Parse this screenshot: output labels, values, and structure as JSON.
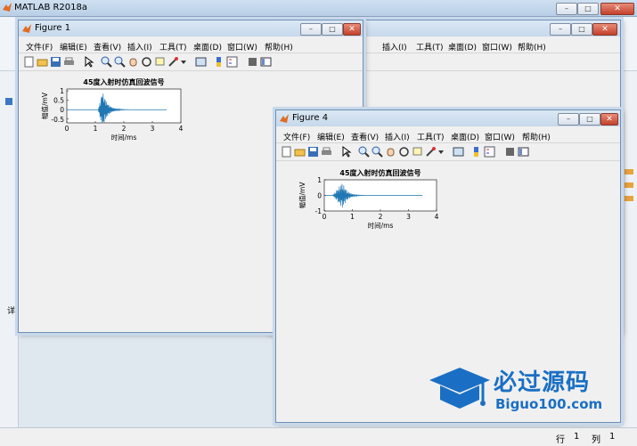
{
  "main": {
    "title": "MATLAB R2018a",
    "status": {
      "row_label": "行",
      "row": "1",
      "col_label": "列",
      "col": "1"
    }
  },
  "figure1": {
    "title": "Figure 1",
    "menu": [
      "文件(F)",
      "编辑(E)",
      "查看(V)",
      "插入(I)",
      "工具(T)",
      "桌面(D)",
      "窗口(W)",
      "帮助(H)"
    ]
  },
  "figure4": {
    "title": "Figure 4",
    "menu": [
      "文件(F)",
      "编辑(E)",
      "查看(V)",
      "插入(I)",
      "工具(T)",
      "桌面(D)",
      "窗口(W)",
      "帮助(H)"
    ]
  },
  "chart_data": [
    {
      "type": "line",
      "title": "45度入射时仿真回波信号",
      "xlabel": "时间/ms",
      "ylabel": "幅值/mV",
      "xlim": [
        0,
        4
      ],
      "ylim": [
        -0.7,
        1.1
      ],
      "xticks": [
        "0",
        "1",
        "2",
        "3",
        "4"
      ],
      "yticks": [
        "1",
        "0.5",
        "0",
        "-0.5"
      ],
      "signal": {
        "start_ms": 0,
        "end_ms": 3.5,
        "burst_start_ms": 1.1,
        "burst_peak_ms": 1.25,
        "peak_amplitude": 1.0,
        "color": "#1f77b4"
      }
    },
    {
      "type": "line",
      "title": "45度入射时仿真回波信号",
      "xlabel": "时间/ms",
      "ylabel": "幅值/mV",
      "xlim": [
        0,
        4
      ],
      "ylim": [
        -1,
        1
      ],
      "xticks": [
        "0",
        "1",
        "2",
        "3",
        "4"
      ],
      "yticks": [
        "1",
        "0",
        "-1"
      ],
      "signal": {
        "start_ms": 0,
        "end_ms": 3.5,
        "burst_start_ms": 0.3,
        "burst_peak_ms": 0.65,
        "peak_amplitude": 0.85,
        "color": "#1f77b4"
      }
    }
  ],
  "watermark": {
    "title": "必过源码",
    "url": "Biguo100.com"
  },
  "colors": {
    "accent": "#1f77b4",
    "watermark": "#1a6fc4"
  }
}
